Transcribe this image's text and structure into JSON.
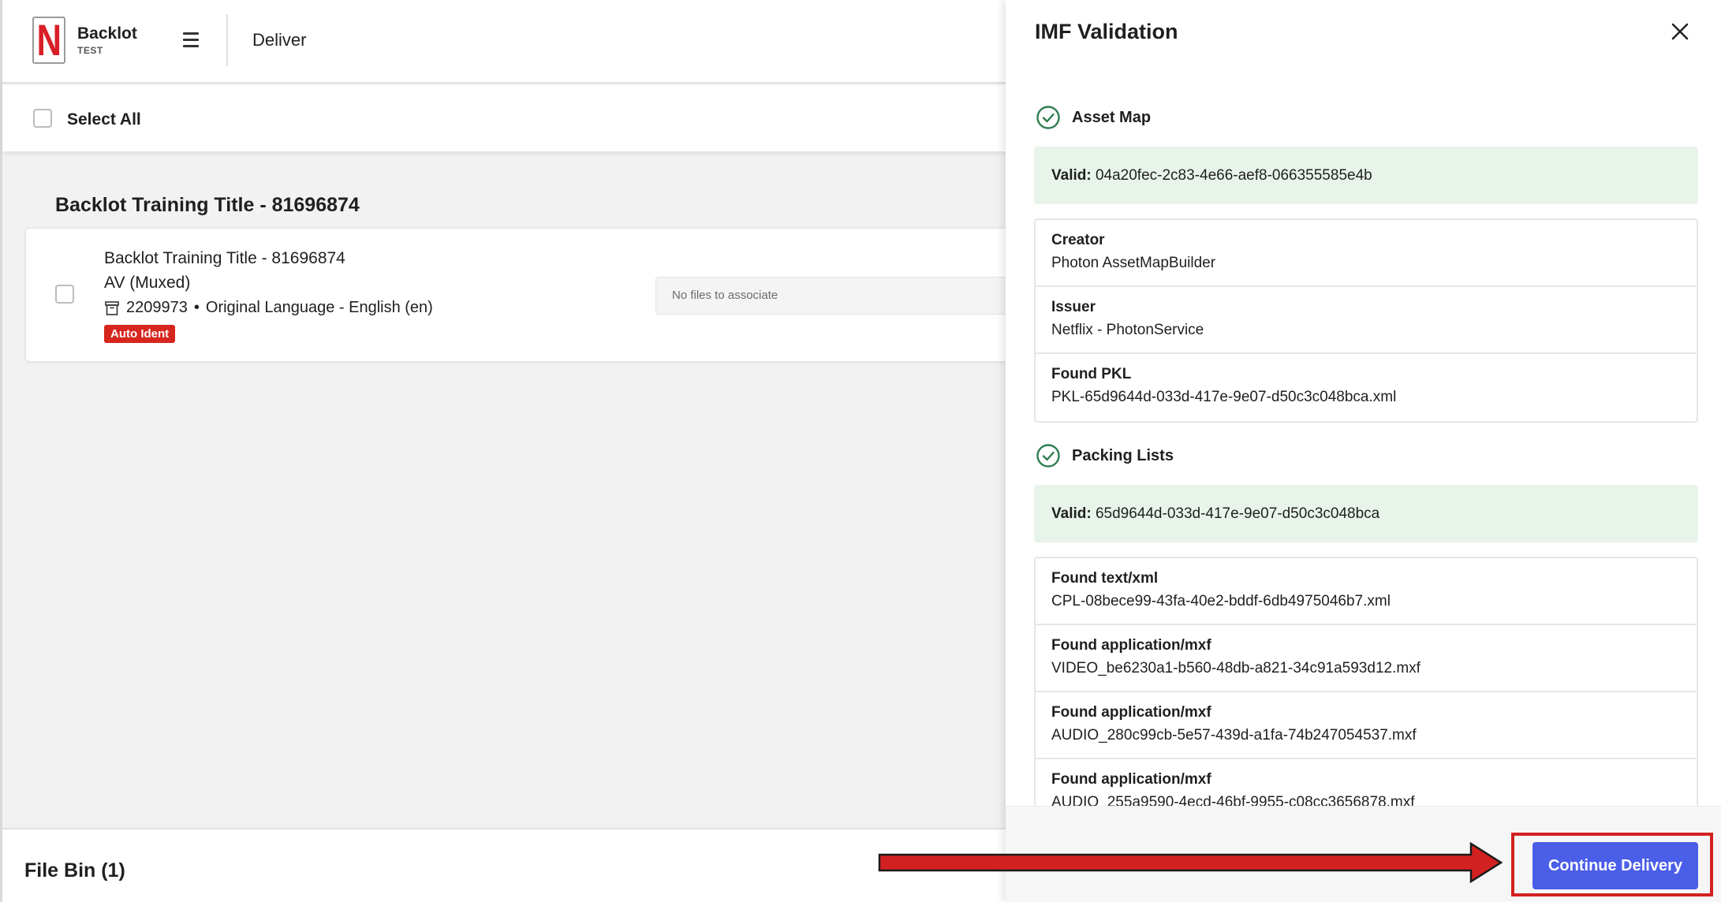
{
  "app": {
    "brand_name": "Backlot",
    "brand_env": "TEST",
    "logo_letter": "N",
    "page_label": "Deliver",
    "accent_color": "#4a5ee8",
    "brand_color": "#d81f26"
  },
  "list": {
    "select_all_label": "Select All",
    "group_title": "Backlot Training Title - 81696874",
    "items": [
      {
        "title": "Backlot Training Title - 81696874",
        "subtitle": "AV (Muxed)",
        "id": "2209973",
        "separator": "•",
        "language": "Original Language - English (en)",
        "badge": "Auto Ident",
        "file_hint": "No files to associate"
      }
    ],
    "file_bin_label": "File Bin (1)"
  },
  "drawer": {
    "title": "IMF Validation",
    "sections": [
      {
        "label": "Asset Map",
        "status_icon": "check-circle-icon",
        "valid_prefix": "Valid:",
        "valid_value": "04a20fec-2c83-4e66-aef8-066355585e4b",
        "properties": [
          {
            "label": "Creator",
            "value": "Photon AssetMapBuilder"
          },
          {
            "label": "Issuer",
            "value": "Netflix - PhotonService"
          },
          {
            "label": "Found PKL",
            "value": "PKL-65d9644d-033d-417e-9e07-d50c3c048bca.xml"
          }
        ]
      },
      {
        "label": "Packing Lists",
        "status_icon": "check-circle-icon",
        "valid_prefix": "Valid:",
        "valid_value": "65d9644d-033d-417e-9e07-d50c3c048bca",
        "properties": [
          {
            "label": "Found text/xml",
            "value": "CPL-08bece99-43fa-40e2-bddf-6db4975046b7.xml"
          },
          {
            "label": "Found application/mxf",
            "value": "VIDEO_be6230a1-b560-48db-a821-34c91a593d12.mxf"
          },
          {
            "label": "Found application/mxf",
            "value": "AUDIO_280c99cb-5e57-439d-a1fa-74b247054537.mxf"
          },
          {
            "label": "Found application/mxf",
            "value": "AUDIO_255a9590-4ecd-46bf-9955-c08cc3656878.mxf"
          }
        ]
      }
    ],
    "continue_label": "Continue Delivery",
    "annotation_color": "#d32121"
  }
}
